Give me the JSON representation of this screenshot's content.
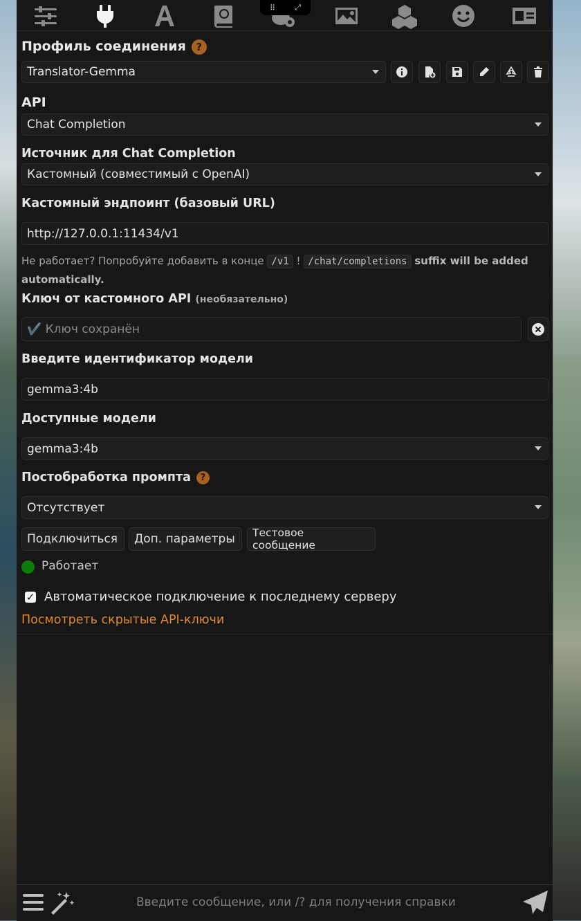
{
  "topbar": {
    "icons": [
      "sliders-icon",
      "plug-icon",
      "font-icon",
      "book-icon",
      "chat-gear-icon",
      "image-icon",
      "cubes-icon",
      "smiley-icon",
      "id-card-icon"
    ],
    "active_icon": "plug-icon"
  },
  "connection_profile": {
    "title": "Профиль соединения",
    "help": "?",
    "selected": "Translator-Gemma"
  },
  "api": {
    "title": "API",
    "selected": "Chat Completion"
  },
  "chat_source": {
    "title": "Источник для Chat Completion",
    "selected": "Кастомный (совместимый с OpenAI)"
  },
  "endpoint": {
    "title": "Кастомный эндпоинт (базовый URL)",
    "value": "http://127.0.0.1:11434/v1",
    "hint_prefix": "Не работает? Попробуйте добавить в конце",
    "hint_code1": "/v1",
    "hint_bang": "!",
    "hint_code2": "/chat/completions",
    "hint_suffix": "suffix will be added automatically."
  },
  "api_key": {
    "title": "Ключ от кастомного API",
    "optional": "(необязательно)",
    "placeholder": "✔️ Ключ сохранён"
  },
  "model_id": {
    "title": "Введите идентификатор модели",
    "value": "gemma3:4b"
  },
  "available_models": {
    "title": "Доступные модели",
    "selected": "gemma3:4b"
  },
  "prompt_postprocessing": {
    "title": "Постобработка промпта",
    "help": "?",
    "selected": "Отсутствует"
  },
  "buttons": {
    "connect": "Подключиться",
    "extra_params": "Доп. параметры",
    "test_message": "Тестовое сообщение"
  },
  "status": {
    "text": "Работает",
    "color": "#0a7d0a"
  },
  "auto_connect": {
    "checked": true,
    "label": "Автоматическое подключение к последнему серверу"
  },
  "hidden_keys_link": "Посмотреть скрытые API-ключи",
  "composer": {
    "placeholder": "Введите сообщение, или /? для получения справки"
  },
  "colors": {
    "accent": "#e08a2c",
    "help_badge": "#a8611f",
    "panel_bg": "#171717"
  }
}
